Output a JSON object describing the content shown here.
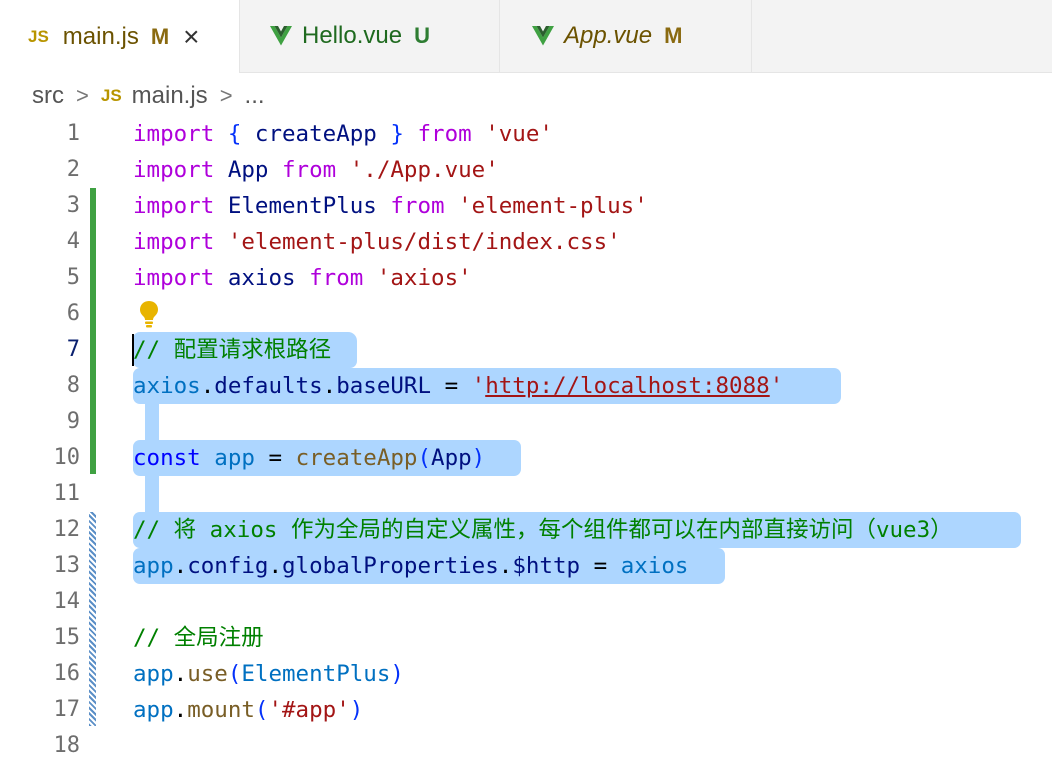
{
  "tabs": [
    {
      "icon": "JS",
      "name": "main.js",
      "status": "M",
      "close": "×"
    },
    {
      "name": "Hello.vue",
      "status": "U"
    },
    {
      "name": "App.vue",
      "status": "M"
    }
  ],
  "breadcrumb": {
    "folder": "src",
    "sep": ">",
    "file_icon": "JS",
    "file": "main.js",
    "more": "..."
  },
  "lines": {
    "n1": "1",
    "n2": "2",
    "n3": "3",
    "n4": "4",
    "n5": "5",
    "n6": "6",
    "n7": "7",
    "n8": "8",
    "n9": "9",
    "n10": "10",
    "n11": "11",
    "n12": "12",
    "n13": "13",
    "n14": "14",
    "n15": "15",
    "n16": "16",
    "n17": "17",
    "n18": "18"
  },
  "code": {
    "l1": {
      "a": "import",
      "b": " { ",
      "c": "createApp",
      "d": " } ",
      "e": "from",
      "f": " ",
      "g": "'vue'"
    },
    "l2": {
      "a": "import",
      "b": " App ",
      "c": "from",
      "d": " ",
      "e": "'./App.vue'"
    },
    "l3": {
      "a": "import",
      "b": " ElementPlus ",
      "c": "from",
      "d": " ",
      "e": "'element-plus'"
    },
    "l4": {
      "a": "import",
      "b": " ",
      "c": "'element-plus/dist/index.css'"
    },
    "l5": {
      "a": "import",
      "b": " axios ",
      "c": "from",
      "d": " ",
      "e": "'axios'"
    },
    "l7": {
      "a": "// 配置请求根路径"
    },
    "l8": {
      "a": "axios",
      "b": ".",
      "c": "defaults",
      "d": ".",
      "e": "baseURL",
      "f": " = ",
      "g": "'",
      "h": "http://localhost:8088",
      "i": "'"
    },
    "l10": {
      "a": "const",
      "b": " ",
      "c": "app",
      "d": " = ",
      "e": "createApp",
      "f": "(",
      "g": "App",
      "h": ")"
    },
    "l12": {
      "a": "// 将 axios 作为全局的自定义属性，每个组件都可以在内部直接访问（vue3）"
    },
    "l13": {
      "a": "app",
      "b": ".",
      "c": "config",
      "d": ".",
      "e": "globalProperties",
      "f": ".",
      "g": "$http",
      "h": " = ",
      "i": "axios"
    },
    "l15": {
      "a": "// 全局注册"
    },
    "l16": {
      "a": "app",
      "b": ".",
      "c": "use",
      "d": "(",
      "e": "ElementPlus",
      "f": ")"
    },
    "l17": {
      "a": "app",
      "b": ".",
      "c": "mount",
      "d": "(",
      "e": "'#app'",
      "f": ")"
    }
  },
  "colors": {
    "selection": "#add6ff",
    "gutter_added": "#3fa142",
    "gutter_modified": "#5b8fc7"
  }
}
